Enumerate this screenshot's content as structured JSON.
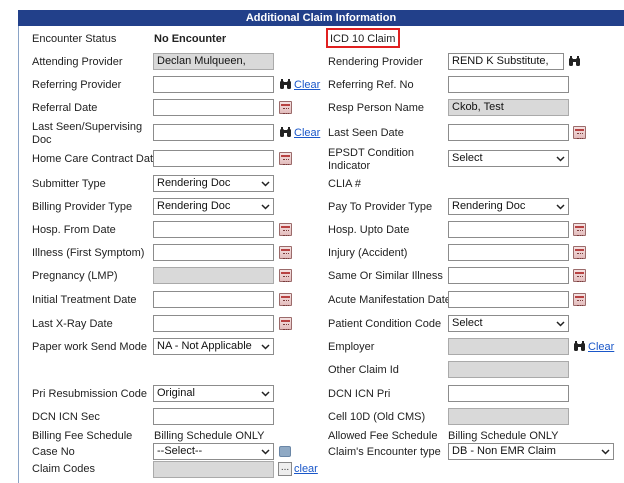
{
  "header": {
    "title": "Additional Claim Information"
  },
  "left": {
    "encounter_status_label": "Encounter Status",
    "encounter_status_value": "No Encounter",
    "attending_provider_label": "Attending Provider",
    "attending_provider_value": "Declan  Mulqueen,",
    "referring_provider_label": "Referring Provider",
    "referral_date_label": "Referral Date",
    "last_seen_supervising_label": "Last Seen/Supervising Doc",
    "home_care_contract_label": "Home Care Contract Date",
    "submitter_type_label": "Submitter Type",
    "submitter_type_value": "Rendering Doc",
    "billing_provider_type_label": "Billing Provider Type",
    "billing_provider_type_value": "Rendering Doc",
    "hosp_from_label": "Hosp. From Date",
    "illness_label": "Illness (First Symptom)",
    "pregnancy_label": "Pregnancy (LMP)",
    "initial_treatment_label": "Initial Treatment Date",
    "last_xray_label": "Last X-Ray Date",
    "paperwork_label": "Paper work Send Mode",
    "paperwork_value": "NA - Not Applicable",
    "pri_resubmission_label": "Pri Resubmission Code",
    "pri_resubmission_value": "Original",
    "dcn_icn_sec_label": "DCN ICN Sec",
    "billing_fee_label": "Billing Fee Schedule",
    "billing_fee_value": "Billing Schedule ONLY",
    "case_no_label": "Case No",
    "case_no_value": "--Select--",
    "claim_codes_label": "Claim Codes",
    "clear_label": "Clear",
    "clear_lower_label": "clear",
    "ellipsis_label": "..."
  },
  "right": {
    "icd_label": "ICD 10 Claim",
    "rendering_provider_label": "Rendering Provider",
    "rendering_provider_value": "REND K  Substitute,",
    "referring_ref_label": "Referring Ref. No",
    "resp_person_label": "Resp Person Name",
    "resp_person_value": "Ckob, Test",
    "last_seen_date_label": "Last Seen Date",
    "epsdt_label": "EPSDT Condition Indicator",
    "epsdt_value": "Select",
    "clia_label": "CLIA #",
    "pay_to_label": "Pay To Provider Type",
    "pay_to_value": "Rendering Doc",
    "hosp_upto_label": "Hosp. Upto Date",
    "injury_label": "Injury (Accident)",
    "same_similar_label": "Same Or Similar Illness",
    "acute_label": "Acute Manifestation Date",
    "patient_condition_label": "Patient Condition Code",
    "patient_condition_value": "Select",
    "employer_label": "Employer",
    "other_claim_label": "Other Claim Id",
    "dcn_icn_pri_label": "DCN ICN Pri",
    "cell10d_label": "Cell 10D (Old CMS)",
    "allowed_fee_label": "Allowed Fee Schedule",
    "allowed_fee_value": "Billing Schedule ONLY",
    "claims_encounter_label": "Claim's Encounter type",
    "claims_encounter_value": "DB - Non EMR Claim",
    "clear_label": "Clear"
  }
}
